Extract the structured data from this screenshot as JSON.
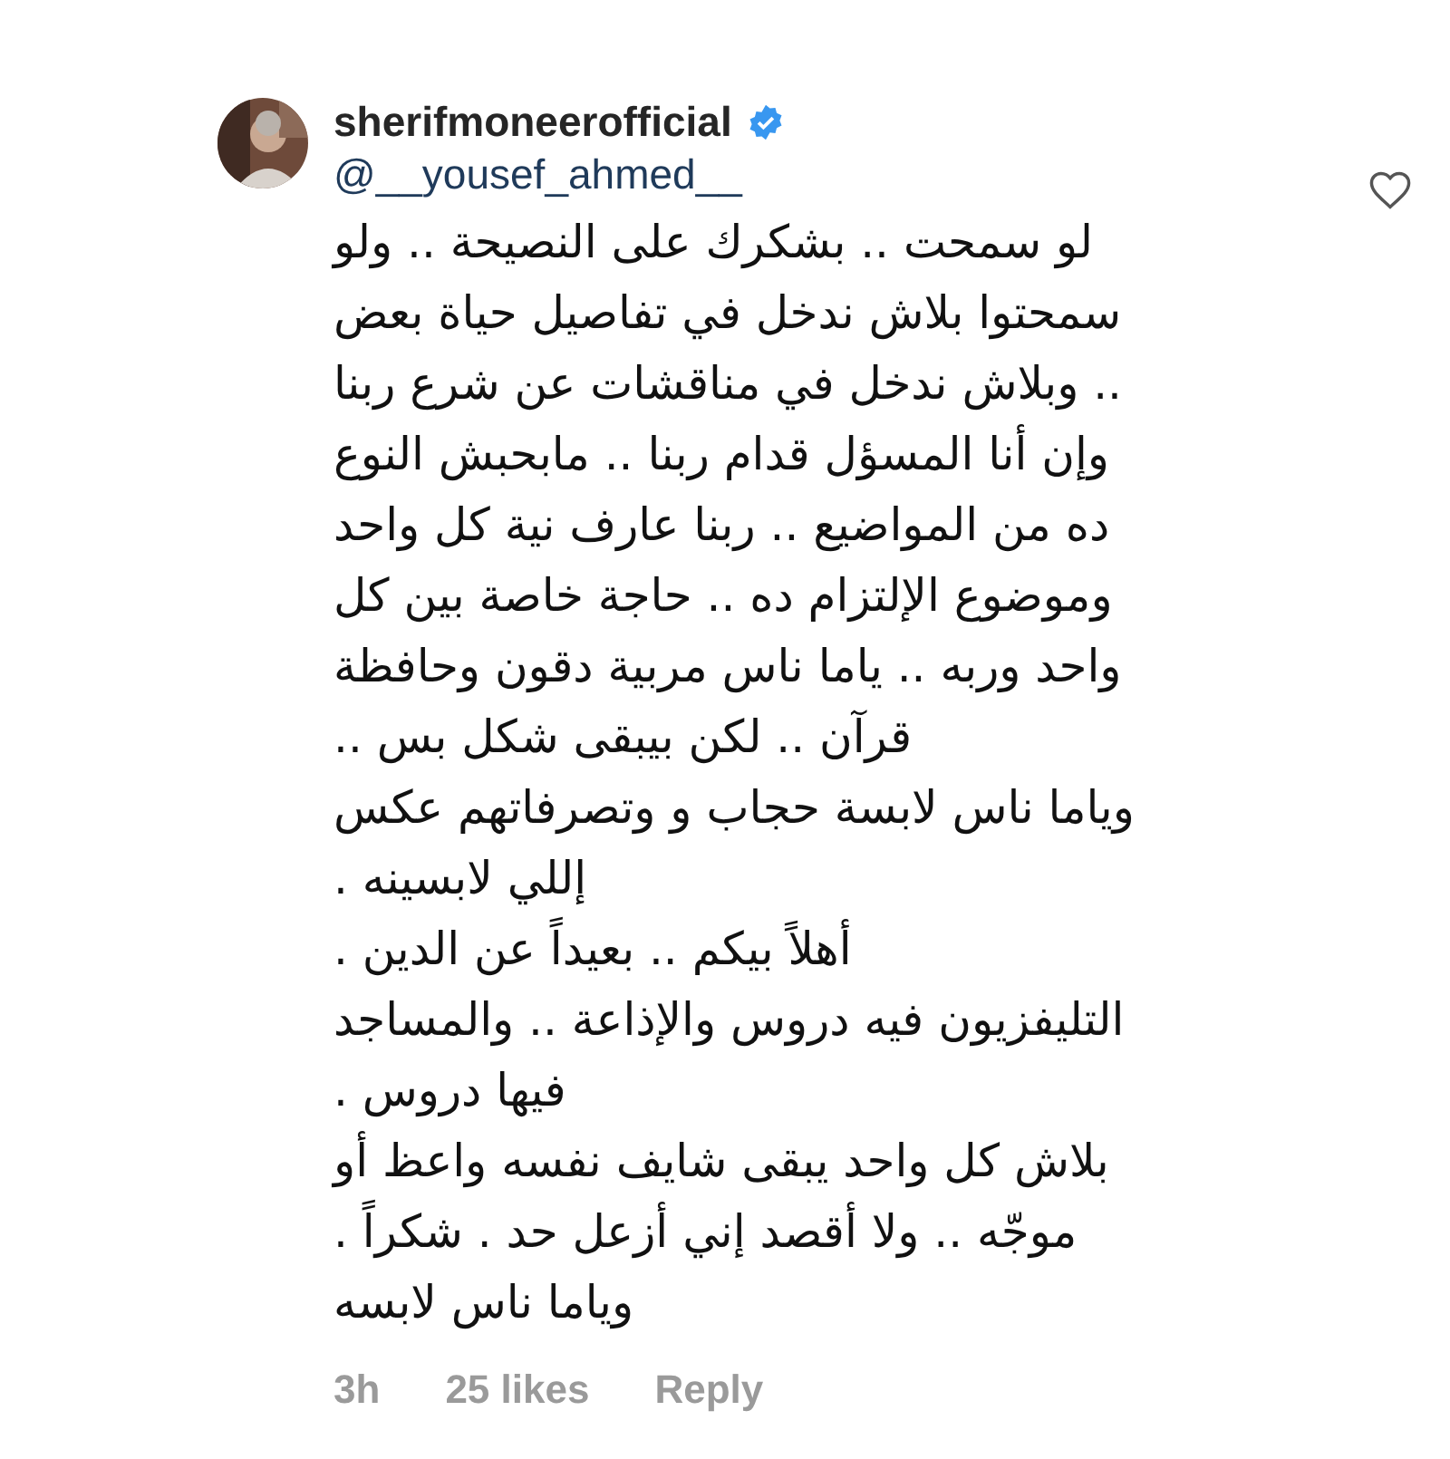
{
  "comment": {
    "author": "sherifmoneerofficial",
    "verified": true,
    "mention": "@__yousef_ahmed__",
    "liked": false,
    "lines": [
      "لو سمحت .. بشكرك على النصيحة .. ولو",
      "سمحتوا بلاش ندخل في تفاصيل حياة بعض",
      ".. وبلاش ندخل في مناقشات عن شرع ربنا",
      "وإن أنا المسؤل قدام ربنا .. مابحبش النوع",
      "ده من المواضيع .. ربنا عارف نية كل واحد",
      "وموضوع الإلتزام ده .. حاجة خاصة بين كل",
      "واحد وربه .. ياما ناس مربية دقون وحافظة",
      "قرآن .. لكن بيبقى شكل بس ..",
      "وياما ناس لابسة حجاب و وتصرفاتهم عكس",
      "إللي لابسينه .",
      "أهلاً بيكم .. بعيداً عن الدين .",
      "التليفزيون فيه دروس والإذاعة .. والمساجد",
      "فيها دروس .",
      "بلاش كل واحد يبقى شايف نفسه واعظ أو",
      "موجّه .. ولا أقصد إني أزعل حد .  شكراً .",
      "وياما ناس لابسه"
    ],
    "time": "3h",
    "likes": "25 likes",
    "reply": "Reply"
  }
}
